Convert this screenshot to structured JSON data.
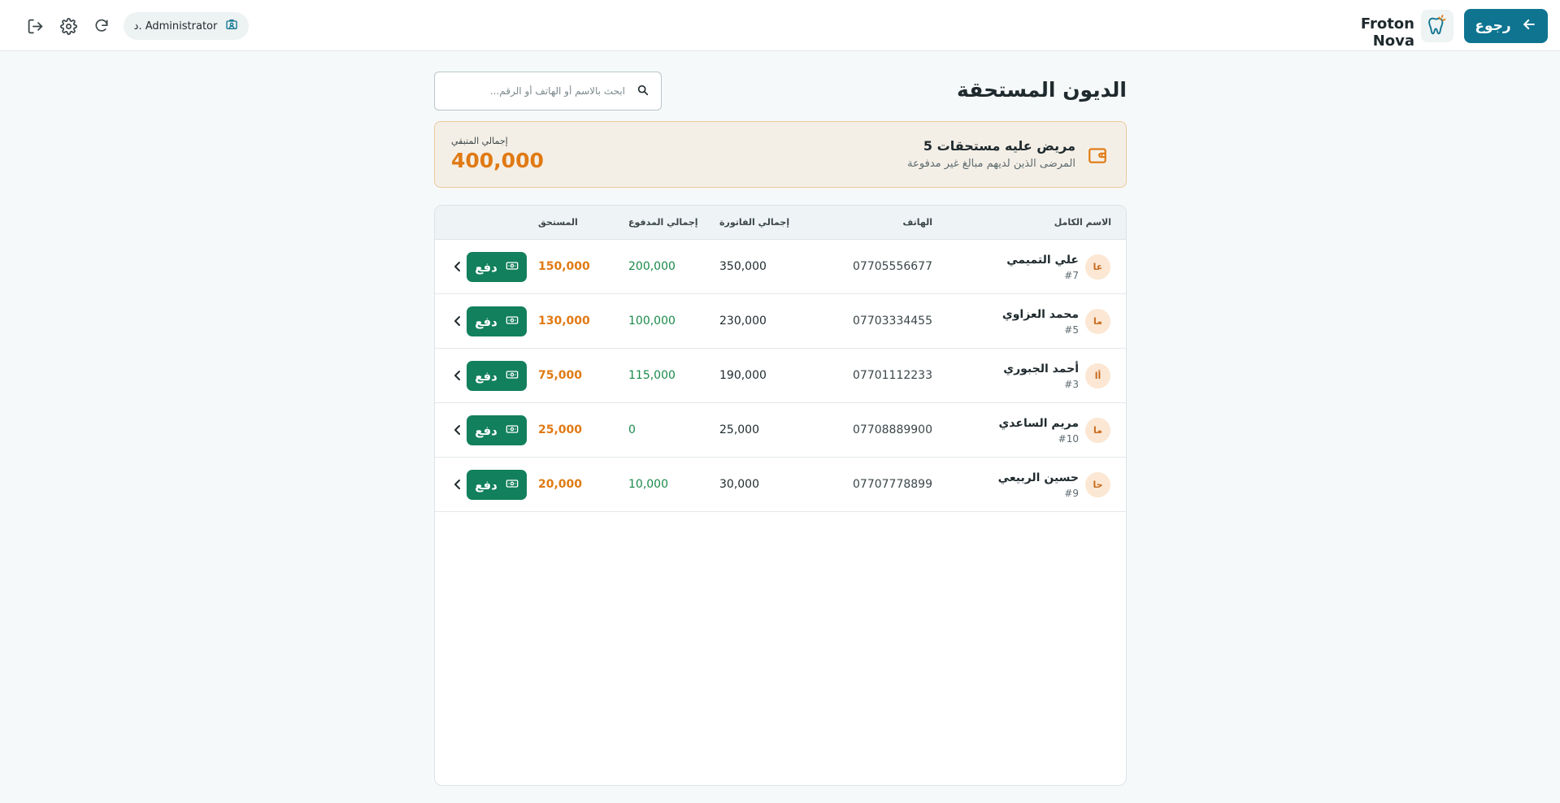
{
  "header": {
    "back_label": "رجوع",
    "brand": "Froton Nova",
    "user_label": "د. Administrator",
    "icons": [
      "logout-icon",
      "settings-icon",
      "refresh-icon",
      "id-badge-icon",
      "tooth-logo"
    ]
  },
  "page": {
    "title": "الديون المستحقة",
    "search_placeholder": "ابحث بالاسم أو الهاتف أو الرقم..."
  },
  "summary": {
    "title": "5 مريض عليه مستحقات",
    "subtitle": "المرضى الذين لديهم مبالغ غير مدفوعة",
    "total_label": "إجمالي المتبقي",
    "total_value": "400,000"
  },
  "table": {
    "columns": {
      "name": "الاسم الكامل",
      "phone": "الهاتف",
      "invoice": "إجمالي الفاتورة",
      "paid": "إجمالي المدفوع",
      "due": "المستحق"
    },
    "pay_label": "دفع",
    "rows": [
      {
        "initials": "عا",
        "name": "علي التميمي",
        "id": "#7",
        "phone": "07705556677",
        "invoice": "350,000",
        "paid": "200,000",
        "due": "150,000"
      },
      {
        "initials": "ما",
        "name": "محمد العزاوي",
        "id": "#5",
        "phone": "07703334455",
        "invoice": "230,000",
        "paid": "100,000",
        "due": "130,000"
      },
      {
        "initials": "أا",
        "name": "أحمد الجبوري",
        "id": "#3",
        "phone": "07701112233",
        "invoice": "190,000",
        "paid": "115,000",
        "due": "75,000"
      },
      {
        "initials": "ما",
        "name": "مريم الساعدي",
        "id": "#10",
        "phone": "07708889900",
        "invoice": "25,000",
        "paid": "0",
        "due": "25,000"
      },
      {
        "initials": "حا",
        "name": "حسين الربيعي",
        "id": "#9",
        "phone": "07707778899",
        "invoice": "30,000",
        "paid": "10,000",
        "due": "20,000"
      }
    ]
  },
  "colors": {
    "primary": "#0e7490",
    "pay_button": "#12805c",
    "due": "#e07a14",
    "paid": "#1a8a4a",
    "summary_bg": "#f4efe6"
  }
}
